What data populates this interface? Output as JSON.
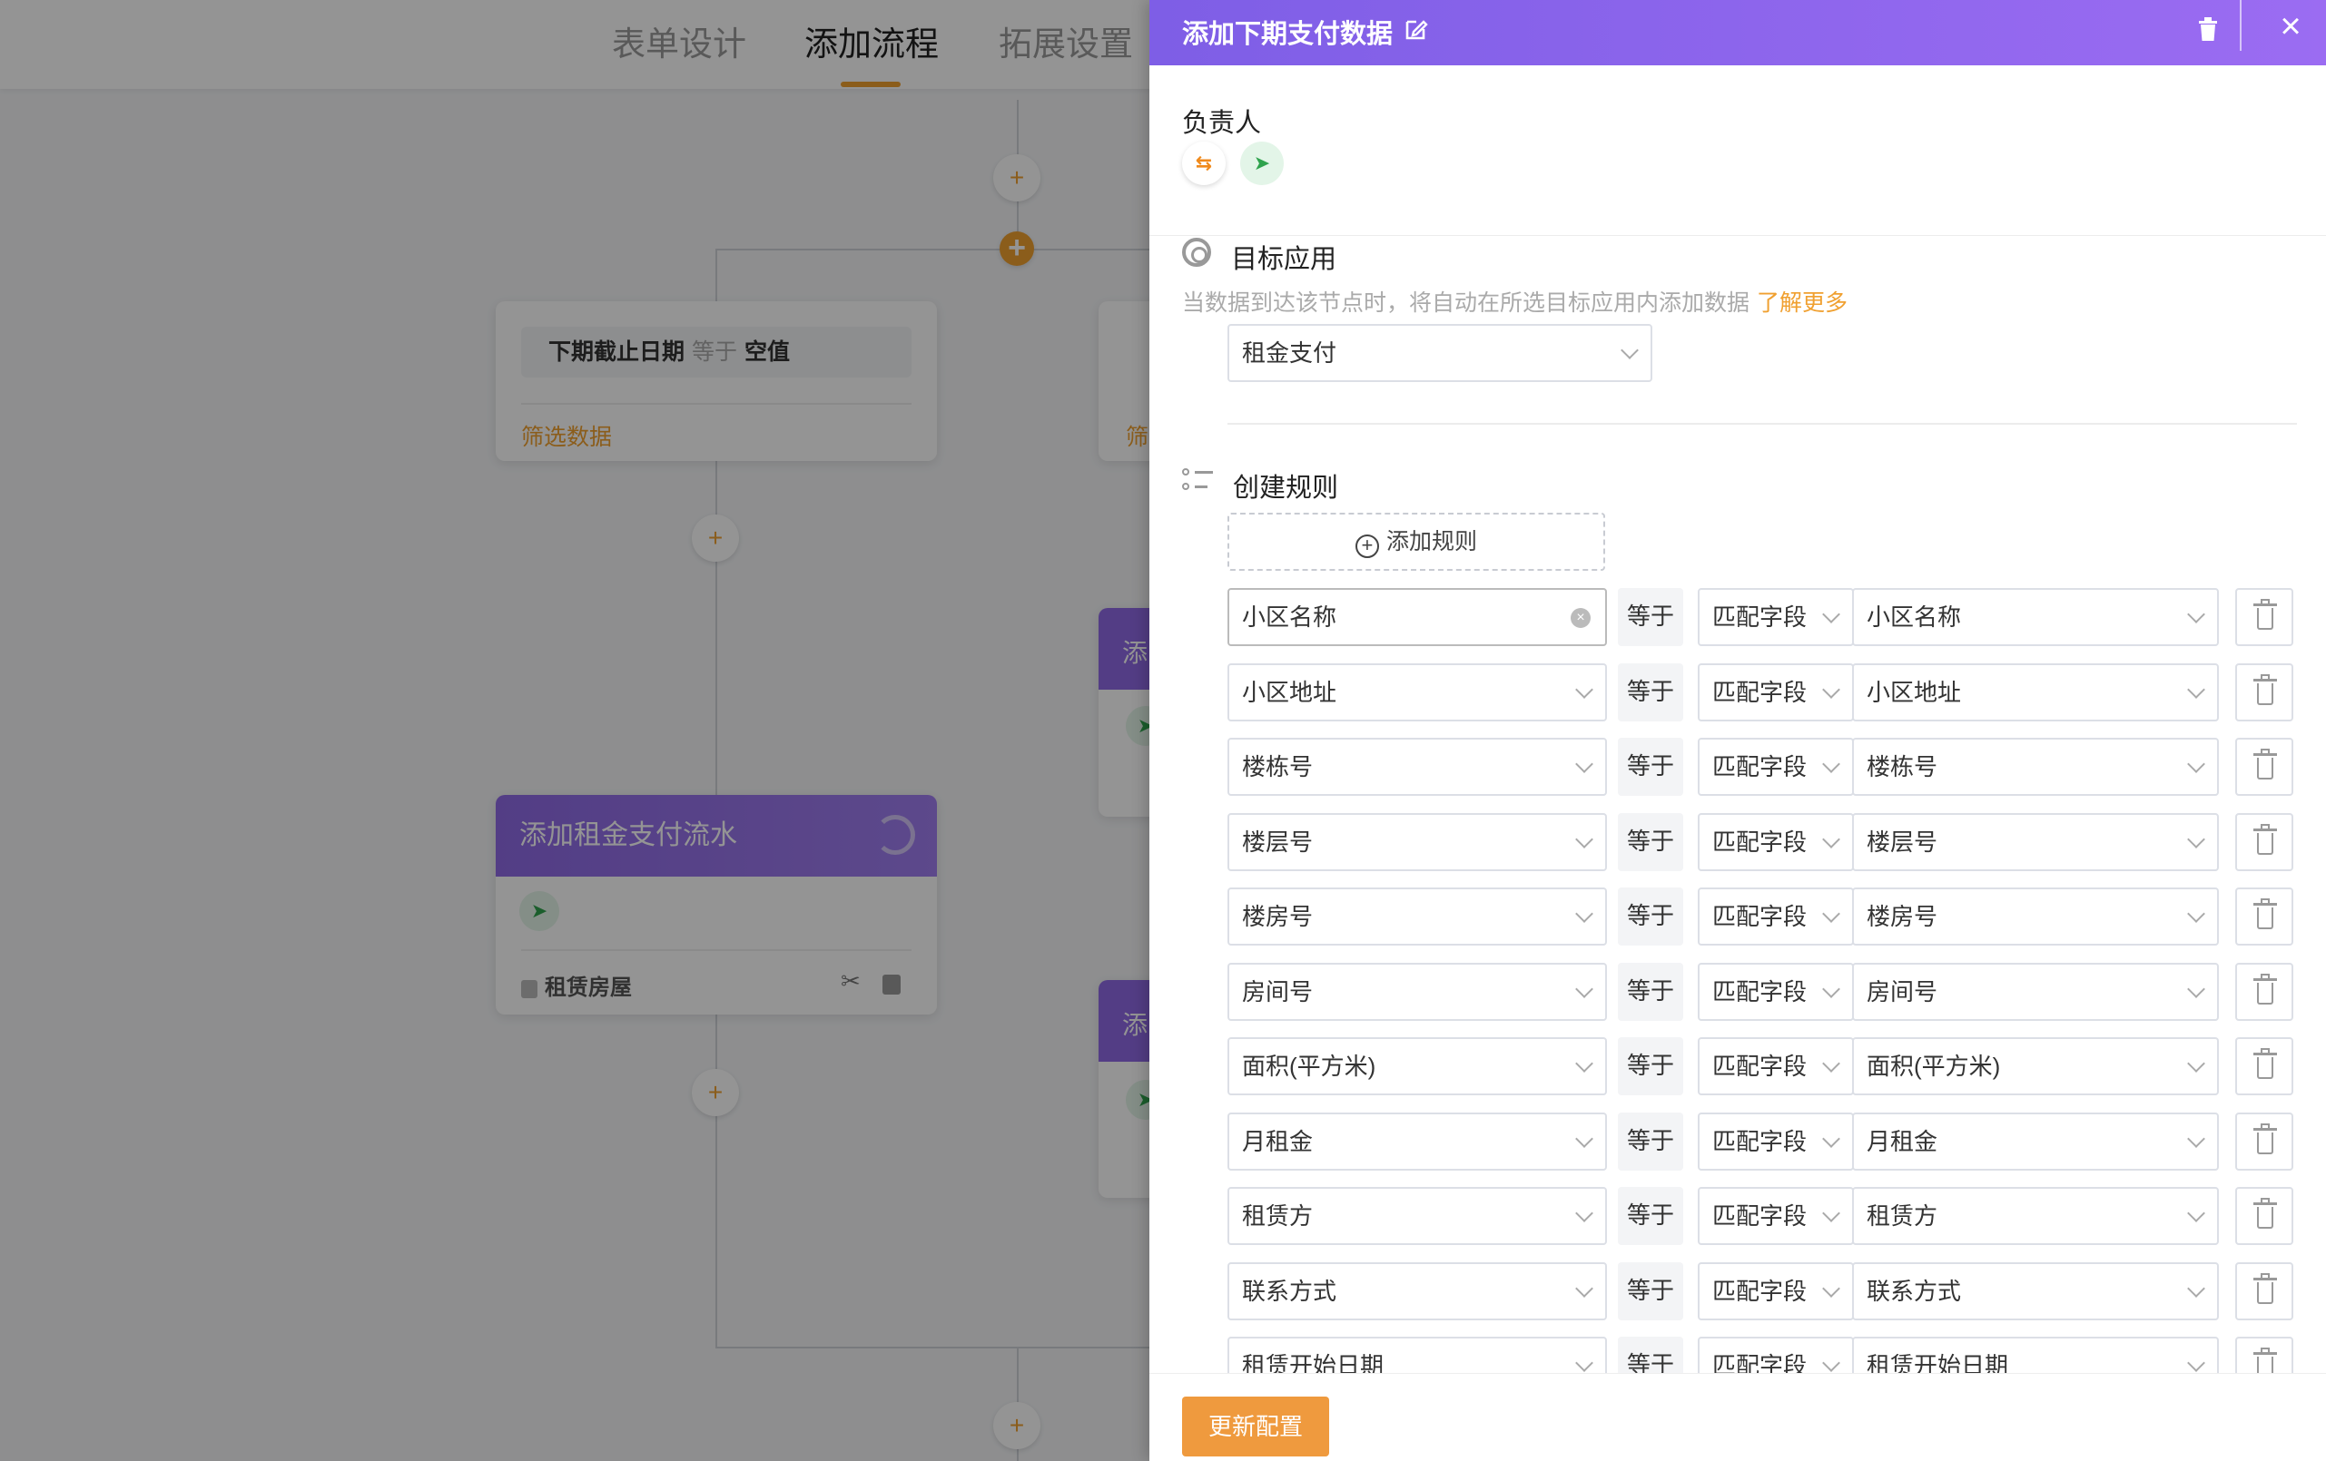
{
  "top_tabs": [
    "表单设计",
    "添加流程",
    "拓展设置"
  ],
  "active_tab": "添加流程",
  "canvas": {
    "condition_card": {
      "field": "下期截止日期",
      "operator": "等于",
      "value": "空值",
      "link": "筛选数据"
    },
    "partial_link": "筛",
    "action_card": {
      "title": "添加租金支付流水",
      "footer": "租赁房屋"
    },
    "partial_title_1": "添",
    "partial_title_2": "添"
  },
  "drawer": {
    "title": "添加下期支付数据",
    "owner_label": "负责人",
    "target_app": {
      "label": "目标应用",
      "description": "当数据到达该节点时，将自动在所选目标应用内添加数据",
      "learn_more": "了解更多",
      "selected": "租金支付"
    },
    "rules": {
      "label": "创建规则",
      "add_button": "添加规则",
      "items": [
        {
          "field": "小区名称",
          "op": "等于",
          "mode": "匹配字段",
          "target": "小区名称"
        },
        {
          "field": "小区地址",
          "op": "等于",
          "mode": "匹配字段",
          "target": "小区地址"
        },
        {
          "field": "楼栋号",
          "op": "等于",
          "mode": "匹配字段",
          "target": "楼栋号"
        },
        {
          "field": "楼层号",
          "op": "等于",
          "mode": "匹配字段",
          "target": "楼层号"
        },
        {
          "field": "楼房号",
          "op": "等于",
          "mode": "匹配字段",
          "target": "楼房号"
        },
        {
          "field": "房间号",
          "op": "等于",
          "mode": "匹配字段",
          "target": "房间号"
        },
        {
          "field": "面积(平方米)",
          "op": "等于",
          "mode": "匹配字段",
          "target": "面积(平方米)"
        },
        {
          "field": "月租金",
          "op": "等于",
          "mode": "匹配字段",
          "target": "月租金"
        },
        {
          "field": "租赁方",
          "op": "等于",
          "mode": "匹配字段",
          "target": "租赁方"
        },
        {
          "field": "联系方式",
          "op": "等于",
          "mode": "匹配字段",
          "target": "联系方式"
        },
        {
          "field": "租赁开始日期",
          "op": "等于",
          "mode": "匹配字段",
          "target": "租赁开始日期"
        }
      ]
    },
    "update_button": "更新配置"
  }
}
